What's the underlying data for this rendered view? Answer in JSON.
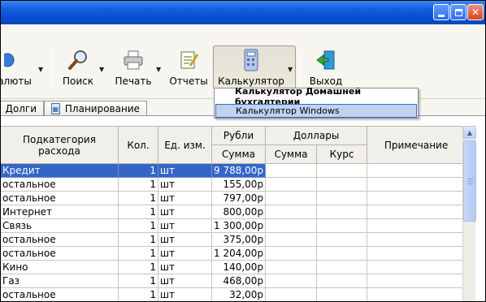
{
  "toolbar": {
    "currency_label": "алюты",
    "search_label": "Поиск",
    "print_label": "Печать",
    "reports_label": "Отчеты",
    "calculator_label": "Калькулятор",
    "exit_label": "Выход"
  },
  "calc_menu": {
    "items": [
      {
        "label": "Калькулятор Домашней бухгалтерии"
      },
      {
        "label": "Калькулятор Windows"
      }
    ]
  },
  "tabs": [
    {
      "label": "Долги"
    },
    {
      "label": "Планирование"
    }
  ],
  "table": {
    "headers": {
      "subcategory": "Подкатегория расхода",
      "qty": "Кол.",
      "unit": "Ед. изм.",
      "rubles": "Рубли",
      "rub_sum": "Сумма",
      "dollars": "Доллары",
      "usd_sum": "Сумма",
      "rate": "Курс",
      "note": "Примечание"
    },
    "rows": [
      {
        "subcategory": "Кредит",
        "qty": "1",
        "unit": "шт",
        "rub_sum": "9 788,00р",
        "selected": true
      },
      {
        "subcategory": "остальное",
        "qty": "1",
        "unit": "шт",
        "rub_sum": "155,00р"
      },
      {
        "subcategory": "остальное",
        "qty": "1",
        "unit": "шт",
        "rub_sum": "797,00р"
      },
      {
        "subcategory": "Интернет",
        "qty": "1",
        "unit": "шт",
        "rub_sum": "800,00р"
      },
      {
        "subcategory": "Связь",
        "qty": "1",
        "unit": "шт",
        "rub_sum": "1 300,00р"
      },
      {
        "subcategory": "остальное",
        "qty": "1",
        "unit": "шт",
        "rub_sum": "375,00р"
      },
      {
        "subcategory": "остальное",
        "qty": "1",
        "unit": "шт",
        "rub_sum": "1 204,00р"
      },
      {
        "subcategory": "Кино",
        "qty": "1",
        "unit": "шт",
        "rub_sum": "140,00р"
      },
      {
        "subcategory": "Газ",
        "qty": "1",
        "unit": "шт",
        "rub_sum": "468,00р"
      },
      {
        "subcategory": "остальное",
        "qty": "1",
        "unit": "шт",
        "rub_sum": "32,00р"
      }
    ]
  },
  "colors": {
    "selection": "#3465c7",
    "titlebar": "#0a4fd0"
  }
}
